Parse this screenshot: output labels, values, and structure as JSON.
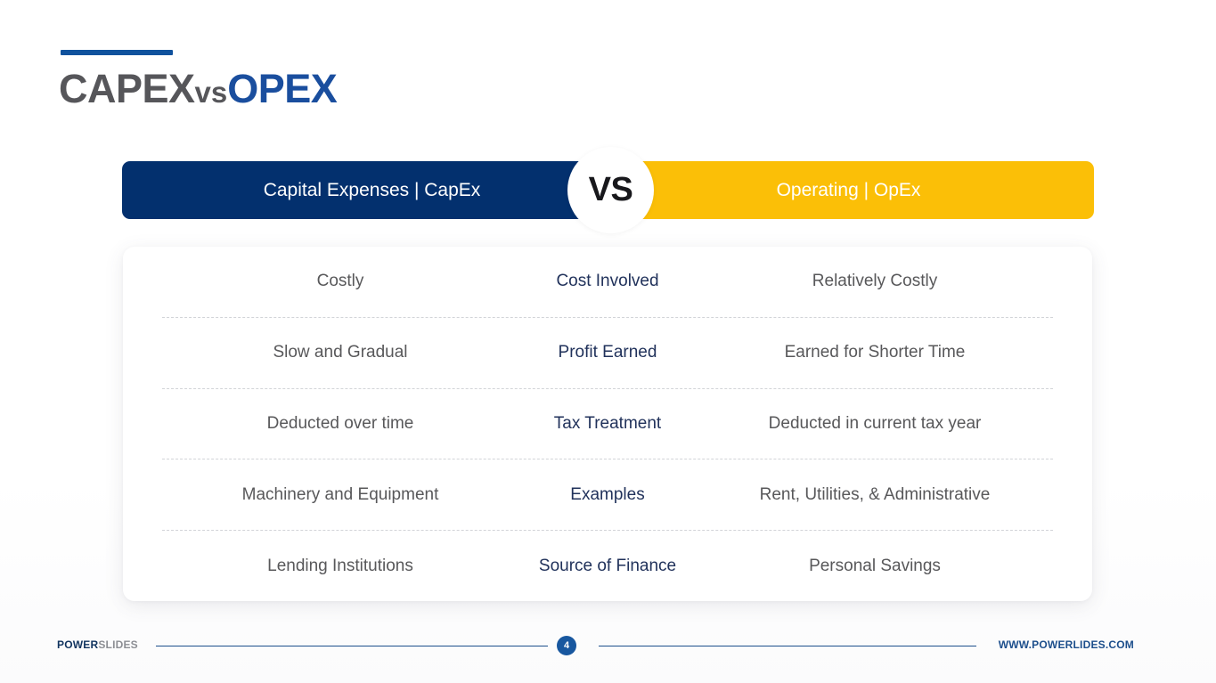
{
  "title": {
    "part1": "CAPEX",
    "connector": "vs",
    "part2": "OPEX",
    "rule_color": "#10529d"
  },
  "header": {
    "left_label": "Capital Expenses | CapEx",
    "center_label": "VS",
    "right_label": "Operating | OpEx",
    "left_color": "#03306e",
    "right_color": "#fbbf07"
  },
  "comparison": {
    "rows": [
      {
        "capex": "Costly",
        "attribute": "Cost Involved",
        "opex": "Relatively Costly"
      },
      {
        "capex": "Slow and Gradual",
        "attribute": "Profit Earned",
        "opex": "Earned for Shorter Time"
      },
      {
        "capex": "Deducted over time",
        "attribute": "Tax Treatment",
        "opex": "Deducted in current tax year"
      },
      {
        "capex": "Machinery and Equipment",
        "attribute": "Examples",
        "opex": "Rent, Utilities, & Administrative"
      },
      {
        "capex": "Lending Institutions",
        "attribute": "Source of Finance",
        "opex": "Personal Savings"
      }
    ]
  },
  "footer": {
    "brand_bold": "POWER",
    "brand_light": "SLIDES",
    "page_number": "4",
    "url": "WWW.POWERLIDES.COM"
  }
}
